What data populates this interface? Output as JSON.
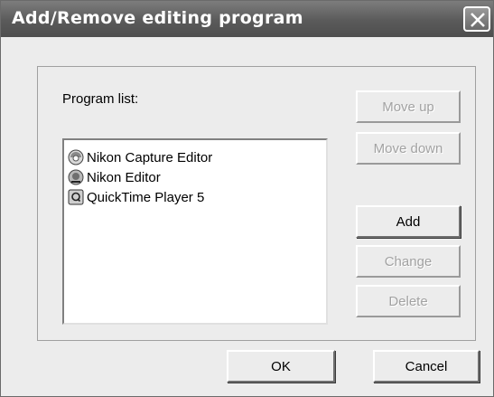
{
  "window": {
    "title": "Add/Remove editing program"
  },
  "labels": {
    "program_list": "Program list:"
  },
  "programs": [
    {
      "name": "Nikon Capture Editor",
      "icon": "nikon-capture-icon"
    },
    {
      "name": "Nikon Editor",
      "icon": "nikon-editor-icon"
    },
    {
      "name": "QuickTime Player 5",
      "icon": "quicktime-icon"
    }
  ],
  "buttons": {
    "move_up": "Move up",
    "move_down": "Move down",
    "add": "Add",
    "change": "Change",
    "delete": "Delete",
    "ok": "OK",
    "cancel": "Cancel"
  },
  "states": {
    "move_up": "disabled",
    "move_down": "disabled",
    "add": "enabled",
    "change": "disabled",
    "delete": "disabled"
  }
}
